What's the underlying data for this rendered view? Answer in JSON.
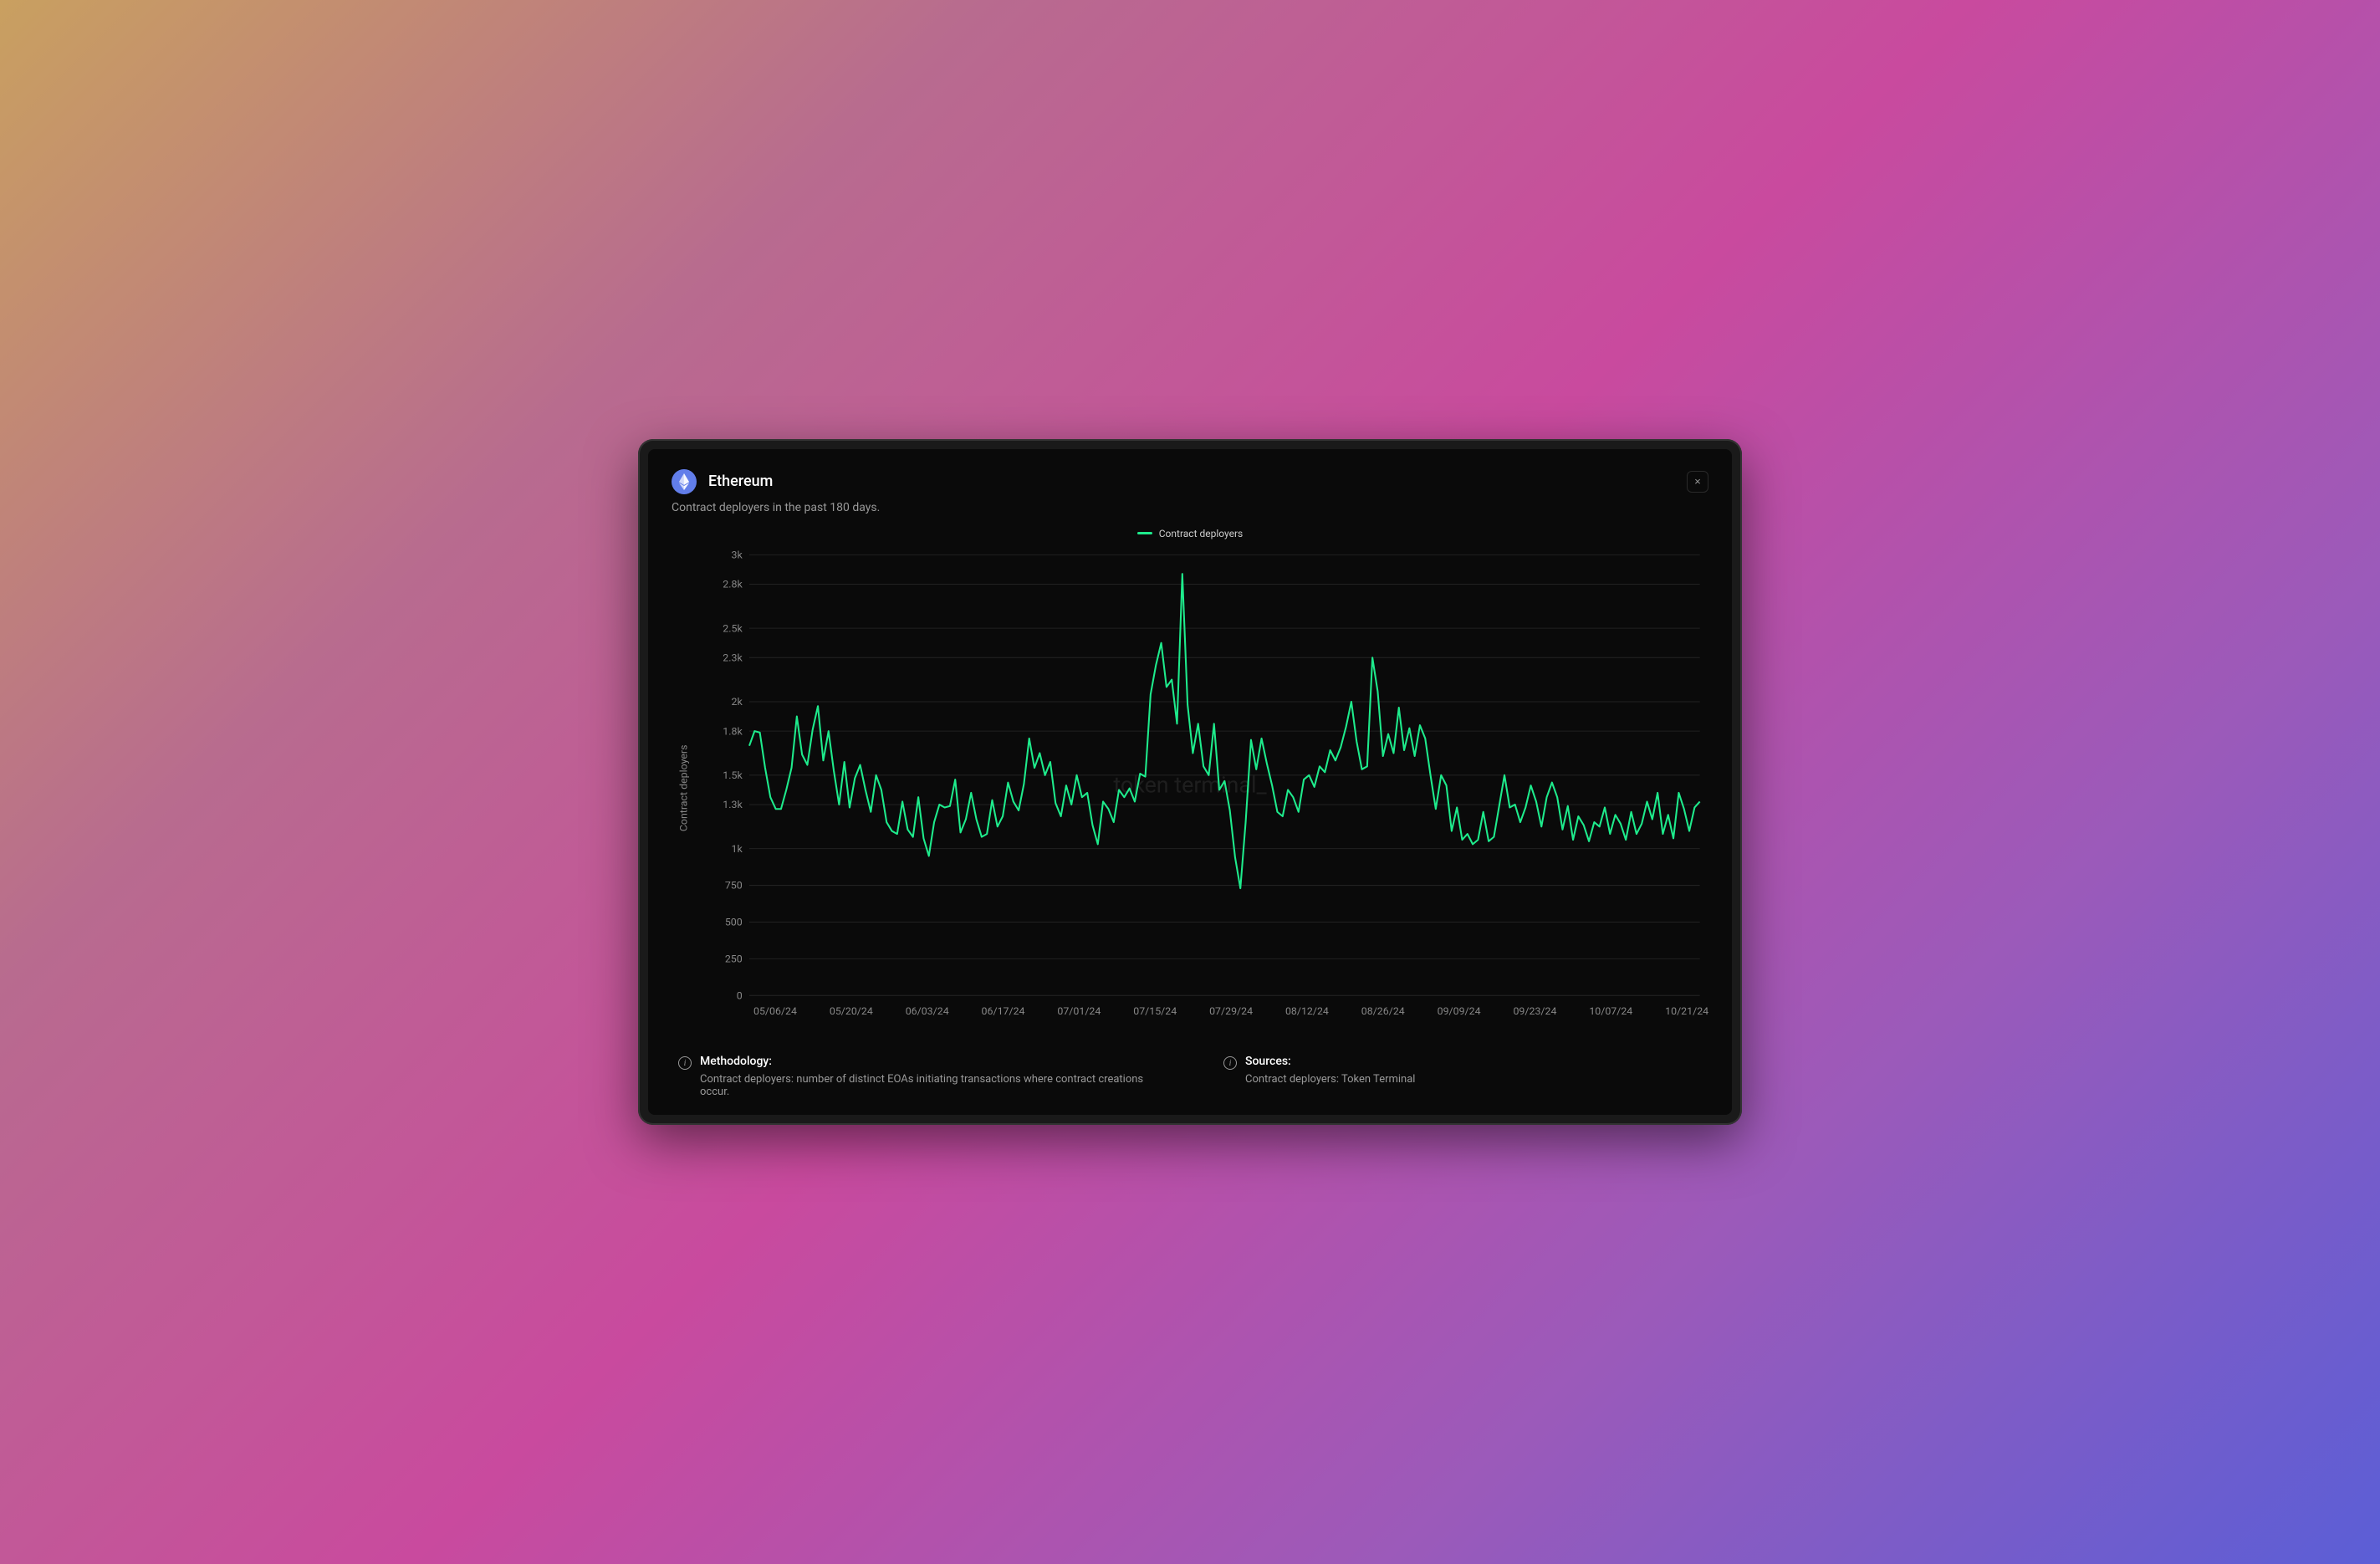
{
  "header": {
    "title": "Ethereum",
    "close_label": "×"
  },
  "subtitle": "Contract deployers in the past 180 days.",
  "legend": {
    "series_label": "Contract deployers"
  },
  "watermark": "token terminal_",
  "yaxis": {
    "title": "Contract deployers"
  },
  "footer": {
    "methodology_label": "Methodology:",
    "methodology_text": "Contract deployers: number of distinct EOAs initiating transactions where contract creations occur.",
    "sources_label": "Sources:",
    "sources_text": "Contract deployers: Token Terminal"
  },
  "chart_data": {
    "type": "line",
    "ylabel": "Contract deployers",
    "xlabel": "",
    "ylim": [
      0,
      3000
    ],
    "y_ticks": [
      0,
      250,
      500,
      750,
      1000,
      1300,
      1500,
      1800,
      2000,
      2300,
      2500,
      2800,
      3000
    ],
    "y_tick_labels": [
      "0",
      "250",
      "500",
      "750",
      "1k",
      "1.3k",
      "1.5k",
      "1.8k",
      "2k",
      "2.3k",
      "2.5k",
      "2.8k",
      "3k"
    ],
    "x_ticks": [
      "05/06/24",
      "05/20/24",
      "06/03/24",
      "06/17/24",
      "07/01/24",
      "07/15/24",
      "07/29/24",
      "08/12/24",
      "08/26/24",
      "09/09/24",
      "09/23/24",
      "10/07/24",
      "10/21/24"
    ],
    "series": [
      {
        "name": "Contract deployers",
        "color": "#1eeb8c",
        "values": [
          1700,
          1800,
          1790,
          1550,
          1350,
          1270,
          1270,
          1400,
          1550,
          1900,
          1640,
          1570,
          1810,
          1970,
          1600,
          1800,
          1530,
          1300,
          1590,
          1280,
          1480,
          1570,
          1400,
          1250,
          1500,
          1400,
          1180,
          1120,
          1100,
          1320,
          1130,
          1080,
          1350,
          1070,
          950,
          1180,
          1300,
          1280,
          1290,
          1470,
          1110,
          1200,
          1380,
          1200,
          1080,
          1100,
          1330,
          1150,
          1220,
          1450,
          1320,
          1260,
          1440,
          1750,
          1550,
          1650,
          1500,
          1590,
          1310,
          1220,
          1430,
          1300,
          1500,
          1350,
          1380,
          1160,
          1030,
          1320,
          1270,
          1180,
          1400,
          1350,
          1410,
          1320,
          1510,
          1490,
          2050,
          2250,
          2400,
          2100,
          2150,
          1850,
          2870,
          1980,
          1650,
          1850,
          1560,
          1500,
          1850,
          1400,
          1460,
          1260,
          940,
          730,
          1180,
          1740,
          1540,
          1750,
          1580,
          1430,
          1250,
          1220,
          1400,
          1350,
          1250,
          1470,
          1500,
          1420,
          1560,
          1520,
          1670,
          1600,
          1690,
          1830,
          2000,
          1730,
          1540,
          1560,
          2300,
          2070,
          1630,
          1780,
          1650,
          1960,
          1670,
          1820,
          1630,
          1840,
          1750,
          1500,
          1270,
          1500,
          1430,
          1120,
          1280,
          1060,
          1100,
          1030,
          1060,
          1250,
          1050,
          1080,
          1290,
          1500,
          1280,
          1300,
          1180,
          1280,
          1430,
          1320,
          1150,
          1350,
          1450,
          1350,
          1130,
          1290,
          1060,
          1220,
          1160,
          1050,
          1180,
          1150,
          1280,
          1100,
          1230,
          1170,
          1060,
          1250,
          1100,
          1170,
          1320,
          1200,
          1380,
          1100,
          1230,
          1070,
          1380,
          1270,
          1120,
          1280,
          1320
        ]
      }
    ]
  }
}
